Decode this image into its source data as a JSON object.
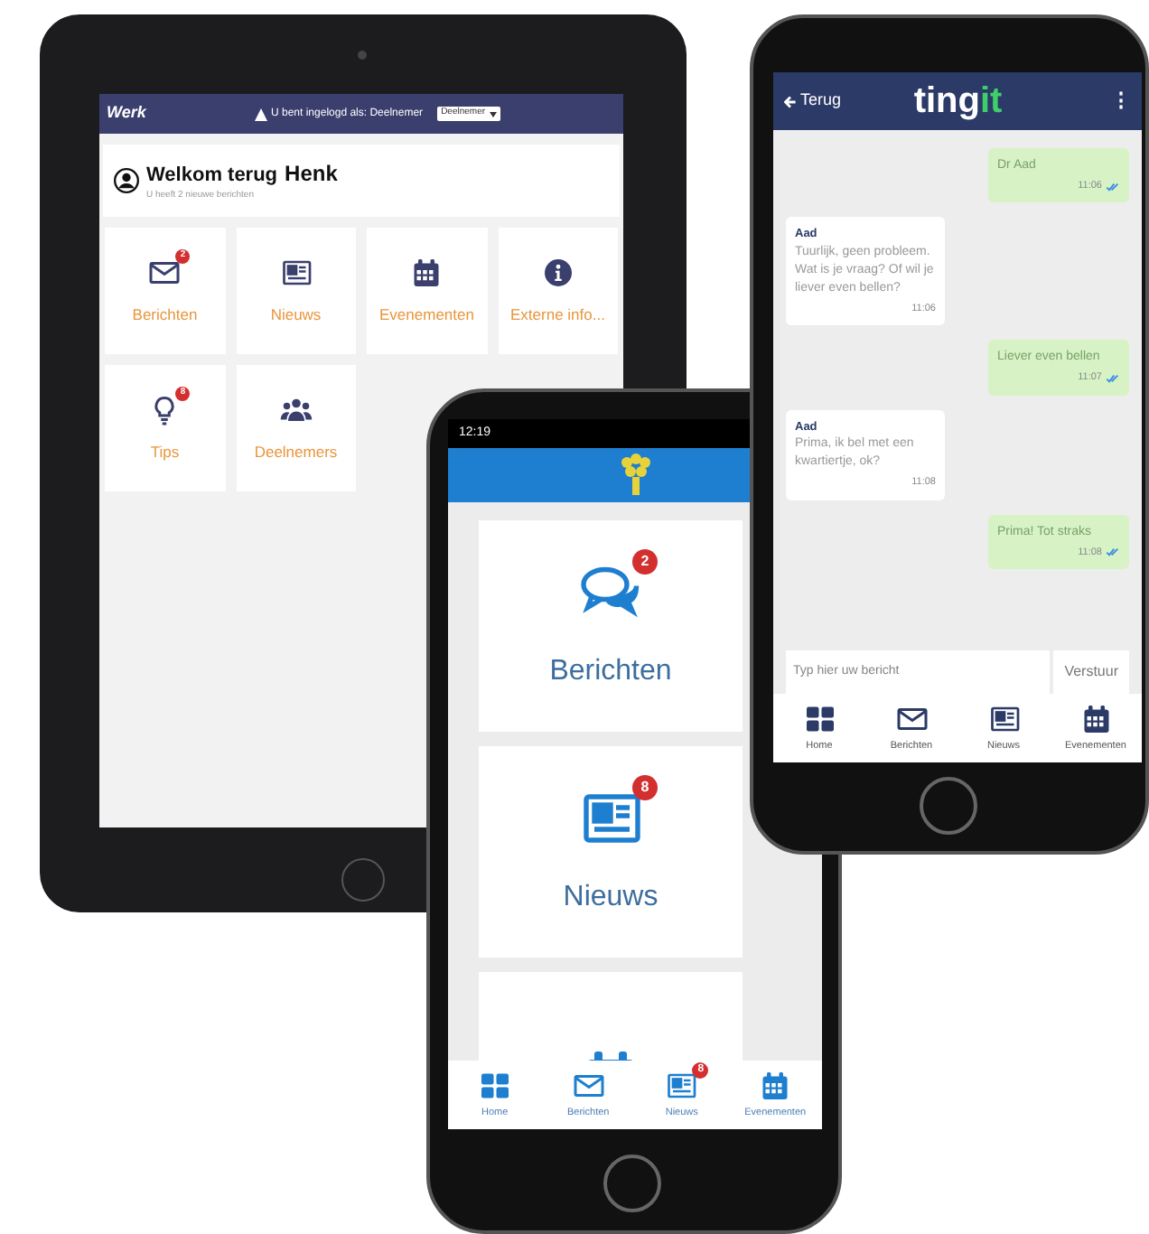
{
  "tablet": {
    "logo_text": "Werk",
    "login_notice": "U bent ingelogd als: Deelnemer",
    "role_select": "Deelnemer",
    "greeting": "Welkom terug",
    "user_name": "Henk",
    "subtitle": "U heeft 2 nieuwe berichten",
    "tiles": [
      {
        "label": "Berichten",
        "kind": "envelope",
        "badge": "2"
      },
      {
        "label": "Nieuws",
        "kind": "newspaper"
      },
      {
        "label": "Evenementen",
        "kind": "calendar"
      },
      {
        "label": "Externe info...",
        "kind": "info"
      },
      {
        "label": "Tips",
        "kind": "bulb",
        "badge": "8"
      },
      {
        "label": "Deelnemers",
        "kind": "people"
      }
    ]
  },
  "middle_phone": {
    "time": "12:19",
    "cards": [
      {
        "label": "Berichten",
        "kind": "chat",
        "badge": "2"
      },
      {
        "label": "Nieuws",
        "kind": "newspaper",
        "badge": "8"
      },
      {
        "kind": "calendar"
      }
    ],
    "nav": [
      {
        "label": "Home",
        "kind": "grid"
      },
      {
        "label": "Berichten",
        "kind": "envelope"
      },
      {
        "label": "Nieuws",
        "kind": "newspaper",
        "badge": "8"
      },
      {
        "label": "Evenementen",
        "kind": "calendar"
      }
    ]
  },
  "chat_phone": {
    "back": "Terug",
    "logo": [
      "ting",
      "it"
    ],
    "menu": "⋮",
    "messages": [
      {
        "kind": "sent",
        "text": "Dr Aad",
        "time": "11:06",
        "read": true
      },
      {
        "kind": "received",
        "sender": "Aad",
        "text": "Tuurlijk, geen probleem. Wat is je vraag? Of wil je liever even bellen?",
        "time": "11:06"
      },
      {
        "kind": "sent",
        "text": "Liever even bellen",
        "time": "11:07",
        "read": true
      },
      {
        "kind": "received",
        "sender": "Aad",
        "text": "Prima, ik bel met een kwartiertje, ok?",
        "time": "11:08"
      },
      {
        "kind": "sent",
        "text": "Prima! Tot straks",
        "time": "11:08",
        "read": true
      }
    ],
    "input_placeholder": "Typ hier uw bericht",
    "send_button": "Verstuur",
    "nav": [
      {
        "label": "Home",
        "kind": "grid"
      },
      {
        "label": "Berichten",
        "kind": "envelope"
      },
      {
        "label": "Nieuws",
        "kind": "newspaper"
      },
      {
        "label": "Evenementen",
        "kind": "calendar"
      }
    ]
  }
}
